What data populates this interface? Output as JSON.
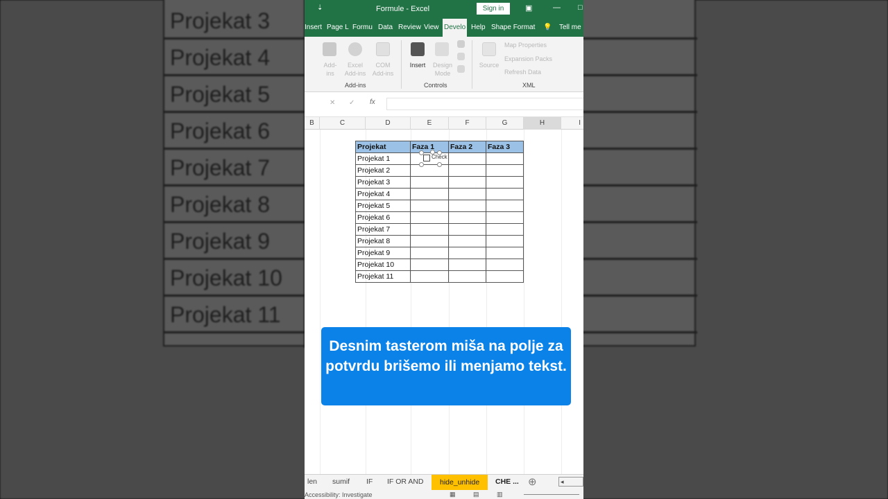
{
  "background": {
    "labels": [
      "Projekat 3",
      "Projekat 4",
      "Projekat 5",
      "Projekat 6",
      "Projekat 7",
      "Projekat 8",
      "Projekat 9",
      "Projekat 10",
      "Projekat 11"
    ]
  },
  "titlebar": {
    "title": "Formule  -  Excel",
    "sign_in": "Sign in"
  },
  "tabs": [
    {
      "label": "Insert"
    },
    {
      "label": "Page L"
    },
    {
      "label": "Formu"
    },
    {
      "label": "Data"
    },
    {
      "label": "Review"
    },
    {
      "label": "View"
    },
    {
      "label": "Develo"
    },
    {
      "label": "Help"
    },
    {
      "label": "Shape Format"
    },
    {
      "label": "Tell me"
    }
  ],
  "ribbon": {
    "addins": {
      "btn1": "Add-\nins",
      "btn2": "Excel\nAdd-ins",
      "btn3": "COM\nAdd-ins",
      "label": "Add-ins"
    },
    "controls": {
      "insert": "Insert",
      "design_mode": "Design\nMode",
      "label": "Controls"
    },
    "xml": {
      "source": "Source",
      "map_properties": "Map Properties",
      "expansion_packs": "Expansion Packs",
      "refresh_data": "Refresh Data",
      "label": "XML"
    }
  },
  "formula_bar": {
    "fx": "fx"
  },
  "columns": [
    "B",
    "C",
    "D",
    "E",
    "F",
    "G",
    "H",
    "I"
  ],
  "table": {
    "headers": [
      "Projekat",
      "Faza 1",
      "Faza 2",
      "Faza 3"
    ],
    "rows": [
      "Projekat 1",
      "Projekat 2",
      "Projekat 3",
      "Projekat 4",
      "Projekat 5",
      "Projekat 6",
      "Projekat 7",
      "Projekat 8",
      "Projekat 9",
      "Projekat 10",
      "Projekat 11"
    ]
  },
  "checkbox": {
    "text": "Check"
  },
  "caption": "Desnim tasterom miša na polje za potvrdu brišemo ili menjamo tekst.",
  "sheet_tabs": [
    "len",
    "sumif",
    "IF",
    "IF OR AND",
    "hide_unhide",
    "CHE ..."
  ],
  "statusbar": {
    "text": "Accessibility: Investigate"
  }
}
